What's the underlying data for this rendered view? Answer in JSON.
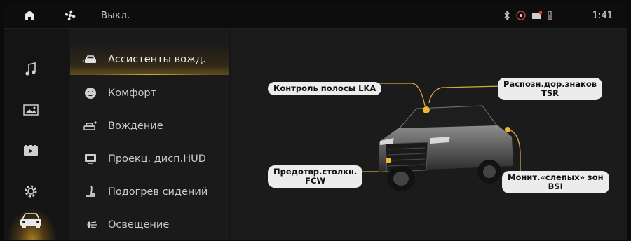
{
  "status_bar": {
    "fan_status": "Выкл.",
    "time": "1:41",
    "icons": [
      "home-icon",
      "fan-icon",
      "bluetooth-icon",
      "signal-icon",
      "message-icon",
      "battery-icon"
    ]
  },
  "rail": {
    "items": [
      "music-icon",
      "gallery-icon",
      "video-icon",
      "settings-icon",
      "car-icon"
    ],
    "active": "car-icon"
  },
  "menu": {
    "items": [
      {
        "label": "Ассистенты вожд.",
        "icon": "driver-assist-icon",
        "active": true
      },
      {
        "label": "Комфорт",
        "icon": "comfort-icon",
        "active": false
      },
      {
        "label": "Вождение",
        "icon": "driving-icon",
        "active": false
      },
      {
        "label": "Проекц. дисп.HUD",
        "icon": "hud-icon",
        "active": false
      },
      {
        "label": "Подогрев сидений",
        "icon": "seat-heating-icon",
        "active": false
      },
      {
        "label": "Освещение",
        "icon": "lighting-icon",
        "active": false
      }
    ]
  },
  "callouts": {
    "lka": "Контроль полосы LKA",
    "tsr_line1": "Распозн.дор.знаков",
    "tsr_line2": "TSR",
    "fcw_line1": "Предотвр.столкн.",
    "fcw_line2": "FCW",
    "bsi_line1": "Монит.«слепых» зон",
    "bsi_line2": "BSI"
  },
  "colors": {
    "accent": "#d8a83a",
    "background": "#161616",
    "callout_bg": "#ececec"
  }
}
